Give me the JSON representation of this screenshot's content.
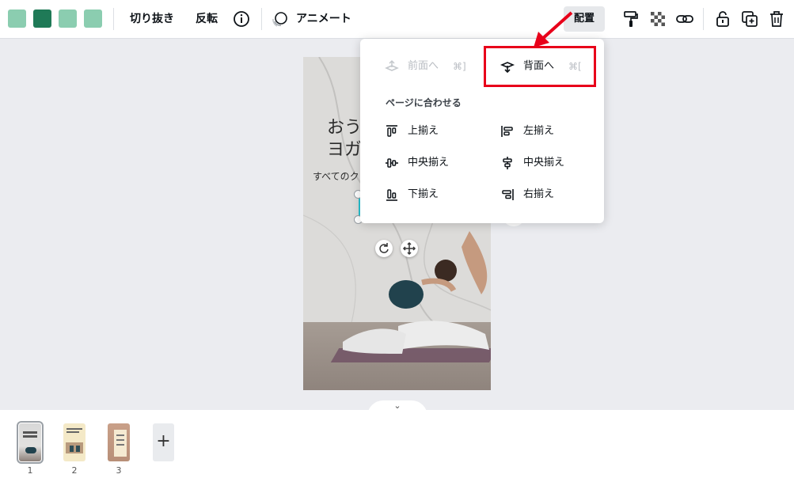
{
  "colors": {
    "swatches": [
      "#8bcdb0",
      "#1f7a57",
      "#8bcdb0",
      "#8bcdb0"
    ],
    "accent_red": "#e8001a",
    "selection": "#27c2d1"
  },
  "toolbar": {
    "crop_label": "切り抜き",
    "flip_label": "反転",
    "info_icon": "info-icon",
    "animate_label": "アニメート",
    "arrange_label": "配置",
    "paint_roller_icon": "paint-roller-icon",
    "transparency_icon": "transparency-icon",
    "link_icon": "link-icon",
    "lock_icon": "lock-icon",
    "duplicate_icon": "duplicate-icon",
    "trash_icon": "trash-icon"
  },
  "canvas": {
    "heading_line1": "おう",
    "heading_line2": "ヨガ",
    "subtitle": "すべてのク"
  },
  "arrange_menu": {
    "forward_label": "前面へ",
    "forward_shortcut": "⌘]",
    "backward_label": "背面へ",
    "backward_shortcut": "⌘[",
    "section_title": "ページに合わせる",
    "align_top": "上揃え",
    "align_left": "左揃え",
    "align_middle": "中央揃え",
    "align_center": "中央揃え",
    "align_bottom": "下揃え",
    "align_right": "右揃え"
  },
  "pages": {
    "numbers": [
      "1",
      "2",
      "3"
    ],
    "add_label": "+",
    "collapse_label": "⌄"
  }
}
